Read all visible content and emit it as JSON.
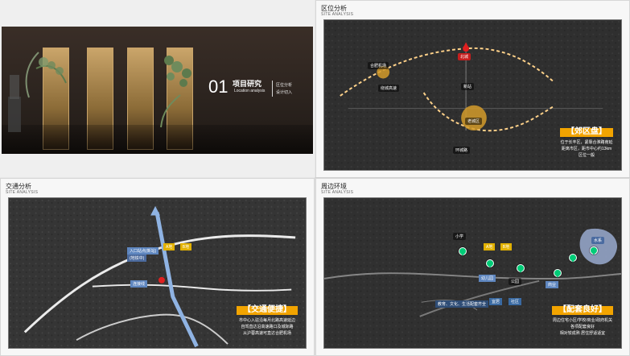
{
  "cover": {
    "number": "01",
    "title": "项目研究",
    "subtitle": "Location analysis",
    "side_line1": "区位分析",
    "side_line2": "设计切入"
  },
  "slides": {
    "location": {
      "title": "区位分析",
      "sub": "SITE ANALYSIS",
      "highlight": "【郊区盘】",
      "note": [
        "位于长丰区，紧靠合淮路南延",
        "距离市区，距市中心约13km",
        "区位一般"
      ],
      "labels": {
        "left_airport": "合肥机场",
        "center_city": "老城区",
        "north_city": "北城",
        "mid_label": "新站",
        "ring_left": "绕城高速",
        "road_mid": "环城路"
      }
    },
    "traffic": {
      "title": "交通分析",
      "sub": "SITE ANALYSIS",
      "highlight": "【交通便捷】",
      "note": [
        "市中心入驻沿每月北路高速延边",
        "自驾直达沿高速路口及城际路",
        "从沪蓉高速可直达合肥机场"
      ],
      "labels": {
        "station_tag": "入口站点(新站)",
        "station_sub": "(地铁中)",
        "road_label": "连接线",
        "box1": "A地",
        "box2": "B地"
      }
    },
    "surroundings": {
      "title": "周边环境",
      "sub": "SITE ANALYSIS",
      "highlight": "【配套良好】",
      "note": [
        "周边住宅小区/学校/商业/政府机关",
        "各项配套良好",
        "相对较成熟  居住舒适适宜"
      ],
      "labels": {
        "school1": "小学",
        "school2": "幼儿园",
        "park": "公园",
        "mall": "商业",
        "center": "教育、文化、生活配套齐全",
        "river": "水系",
        "pin_label1": "宜居",
        "pin_label2": "社区"
      }
    }
  },
  "colors": {
    "accent": "#f2a400",
    "map_dark": "#2f2f2f",
    "route_white": "#ffffff",
    "badge_blue": "#5e86bf"
  }
}
